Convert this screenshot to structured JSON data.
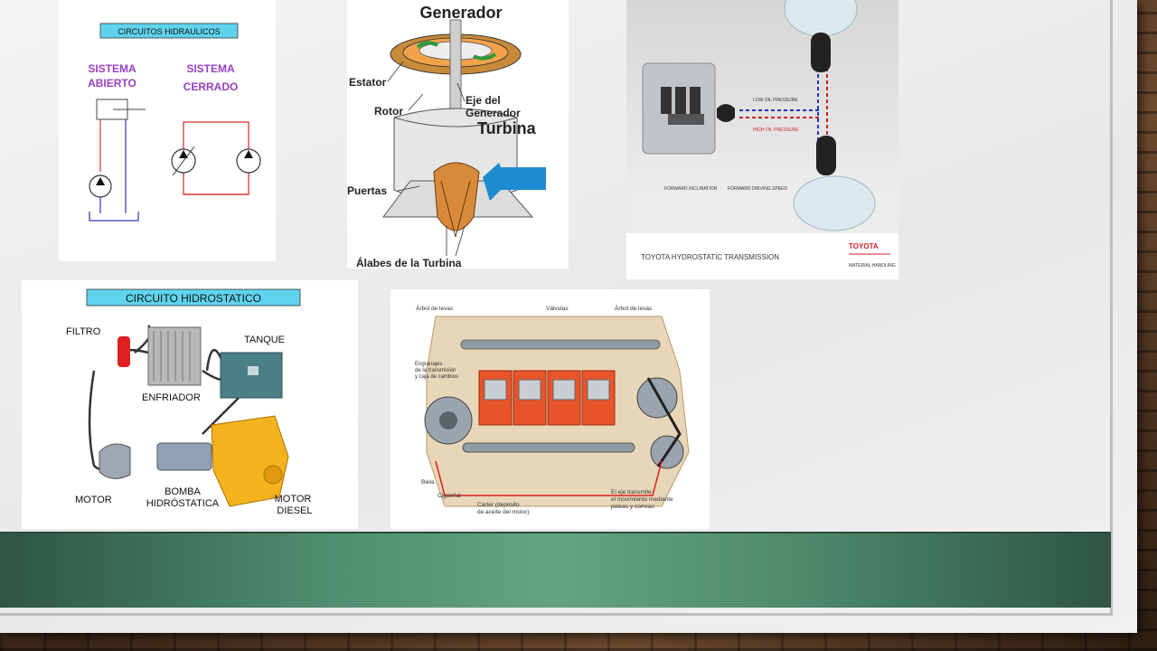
{
  "panels": {
    "circuitos": {
      "header": "CIRCUITOS HIDRAULICOS",
      "open_label_1": "SISTEMA",
      "open_label_2": "ABIERTO",
      "closed_label_1": "SISTEMA",
      "closed_label_2": "CERRADO"
    },
    "generador": {
      "title": "Generador",
      "estator": "Estator",
      "rotor": "Rotor",
      "eje_1": "Eje del",
      "eje_2": "Generador",
      "turbina": "Turbina",
      "puertas": "Puertas",
      "alabes": "Álabes de la Turbina"
    },
    "toyota": {
      "low_pressure": "LOW OIL PRESSURE",
      "high_pressure": "HIGH OIL PRESSURE",
      "caption_left": "FORWARD INCLINATION",
      "caption_right": "FORWARD DRIVING SPEED",
      "footer_title": "TOYOTA HYDROSTATIC TRANSMISSION",
      "brand": "TOYOTA",
      "brand_sub": "MATERIAL HANDLING"
    },
    "hidrostatico": {
      "header": "CIRCUITO HIDROSTATICO",
      "filtro": "FILTRO",
      "tanque": "TANQUE",
      "enfriador": "ENFRIADOR",
      "motor": "MOTOR",
      "bomba_1": "BOMBA",
      "bomba_2": "HIDRÓSTATICA",
      "motor_diesel_1": "MOTOR",
      "motor_diesel_2": "DIESEL"
    },
    "motor": {
      "arbol_1": "Árbol de levas",
      "valvulas": "Válvulas",
      "arbol_2": "Árbol de levas",
      "engranajes_1": "Engranajes",
      "engranajes_2": "de la transmisión",
      "engranajes_3": "y caja de cambios",
      "biela": "Biela",
      "ciguenal": "Cigüeñal",
      "carter_1": "Cárter (depósito",
      "carter_2": "de aceite del motor)",
      "eje_1": "El eje transmite",
      "eje_2": "el movimiento mediante",
      "eje_3": "poleas y correas"
    }
  },
  "colors": {
    "header_cyan": "#5fd3ee",
    "purple_label": "#9a3fc4",
    "band_green": "#4f8f72",
    "toyota_red": "#d0202a"
  }
}
